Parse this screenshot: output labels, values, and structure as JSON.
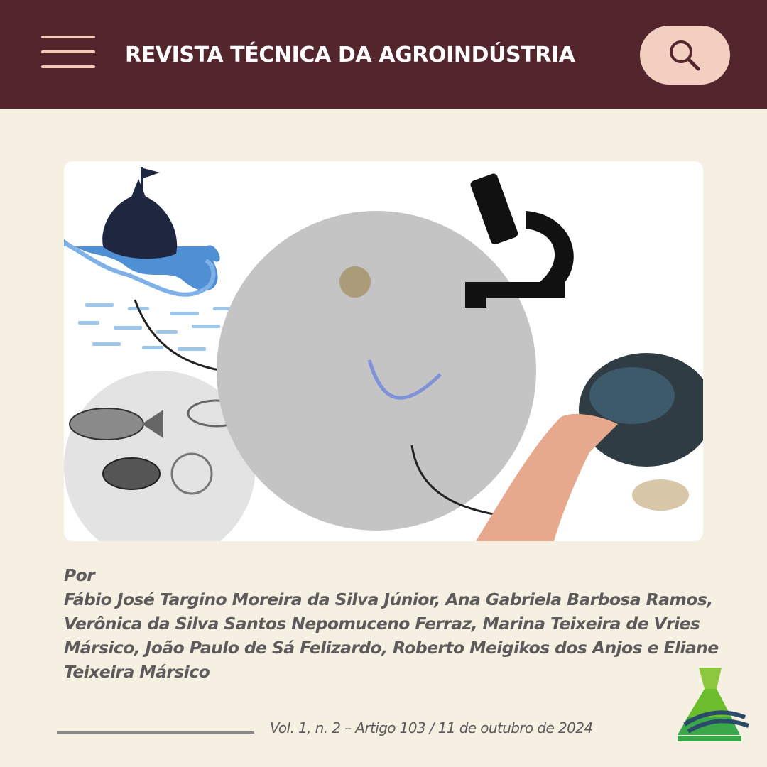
{
  "header": {
    "title": "REVISTA TÉCNICA DA AGROINDÚSTRIA",
    "menu_icon": "hamburger-menu-icon",
    "search_icon": "search-icon",
    "background_color": "#53262e",
    "accent_color": "#f3cfc1"
  },
  "article": {
    "byline_prefix": "Por",
    "authors": "Fábio José Targino Moreira da Silva Júnior, Ana Gabriela Barbosa Ramos, Verônica da Silva Santos Nepomuceno Ferraz, Marina Teixeira de Vries Mársico, João Paulo de Sá Felizardo, Roberto Meigikos dos Anjos e Eliane Teixeira Mársico",
    "citation": "Vol. 1, n. 2 – Artigo 103 / 11 de outubro de 2024"
  },
  "page": {
    "background_color": "#f5f0e1"
  }
}
